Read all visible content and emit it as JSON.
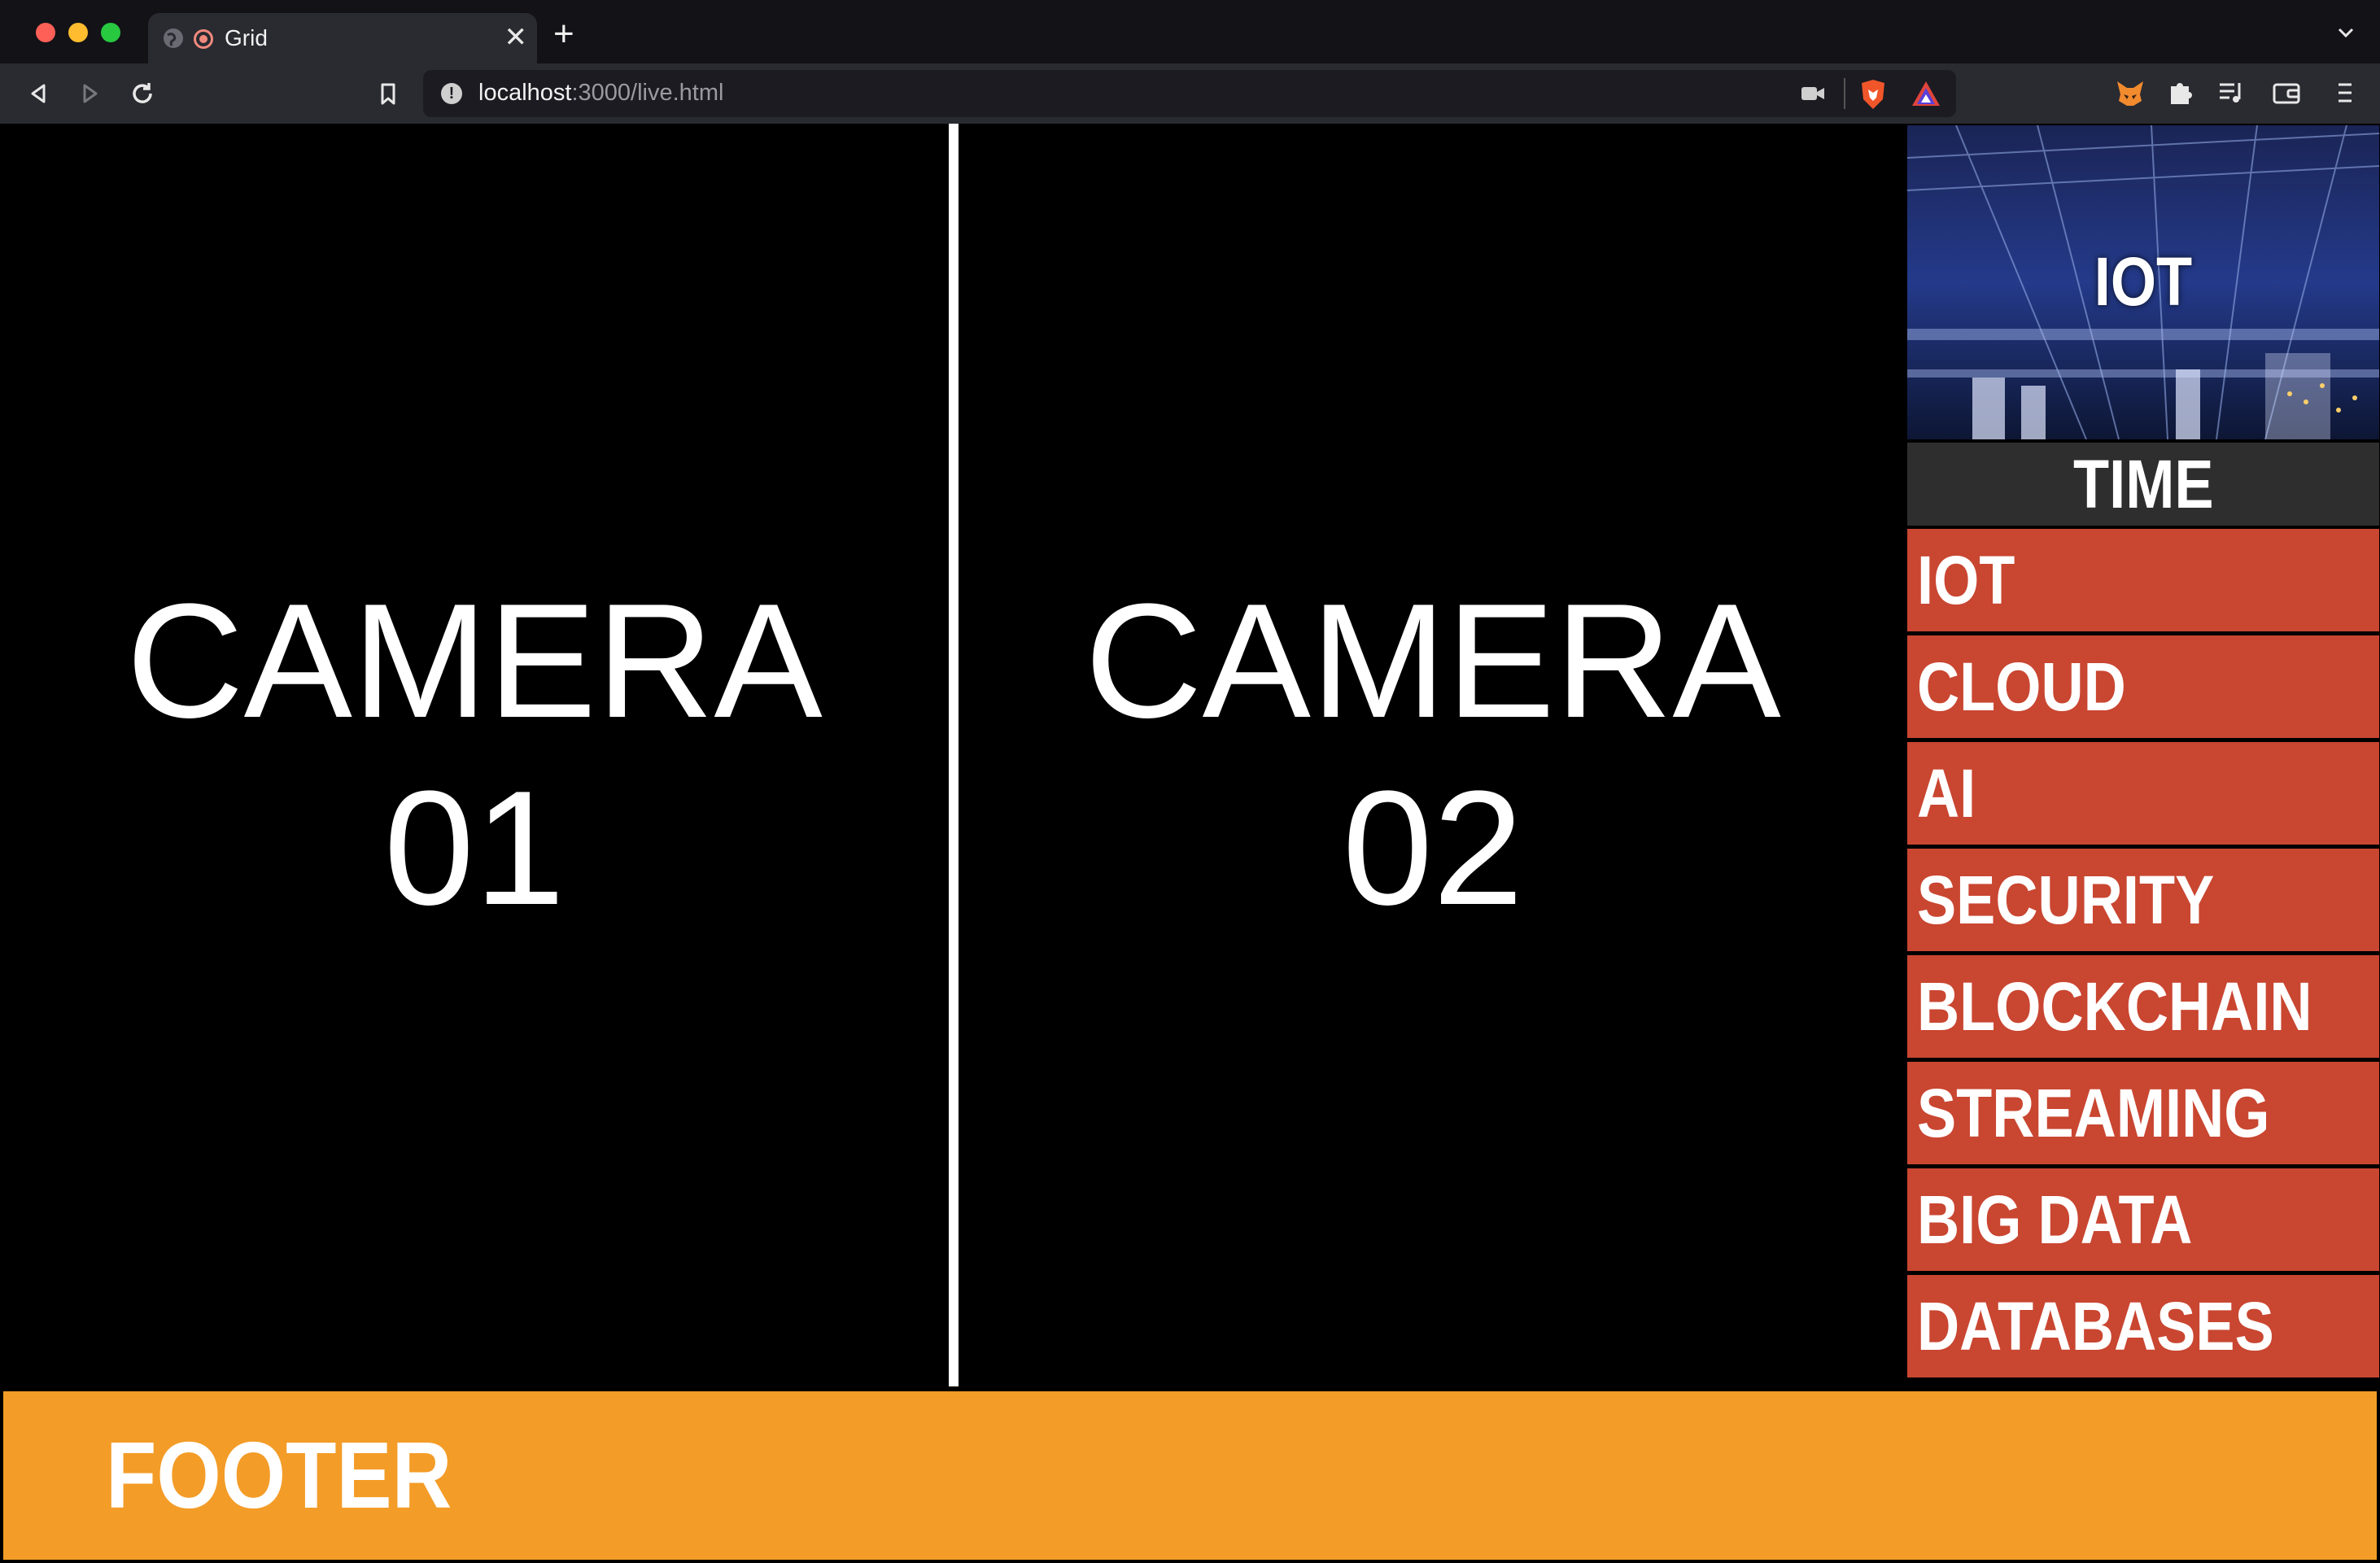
{
  "browser": {
    "tab_title": "Grid",
    "url_host": "localhost",
    "url_rest": ":3000/live.html"
  },
  "icons": {
    "back": "back-arrow-icon",
    "forward": "forward-arrow-icon",
    "reload": "reload-icon",
    "bookmark": "bookmark-icon",
    "site_info": "site-info-icon",
    "camera": "camera-icon",
    "brave_shields": "brave-shields-icon",
    "brave_rewards": "brave-rewards-icon",
    "metamask": "fox-extension-icon",
    "extensions": "puzzle-piece-icon",
    "playlist": "playlist-icon",
    "wallet": "wallet-icon",
    "menu": "hamburger-menu-icon"
  },
  "cameras": [
    {
      "line1": "CAMERA",
      "line2": "01"
    },
    {
      "line1": "CAMERA",
      "line2": "02"
    }
  ],
  "sidebar": {
    "hero_label": "IOT",
    "time_label": "TIME",
    "items": [
      {
        "label": "IOT"
      },
      {
        "label": "CLOUD"
      },
      {
        "label": "AI"
      },
      {
        "label": "SECURITY"
      },
      {
        "label": "BLOCKCHAIN"
      },
      {
        "label": "STREAMING"
      },
      {
        "label": "BIG DATA"
      },
      {
        "label": "DATABASES"
      }
    ]
  },
  "footer": {
    "label": "FOOTER"
  },
  "colors": {
    "menu_bg": "#c94631",
    "footer_bg": "#f39c27",
    "time_bg": "#2e2e2e",
    "page_bg": "#000000"
  }
}
